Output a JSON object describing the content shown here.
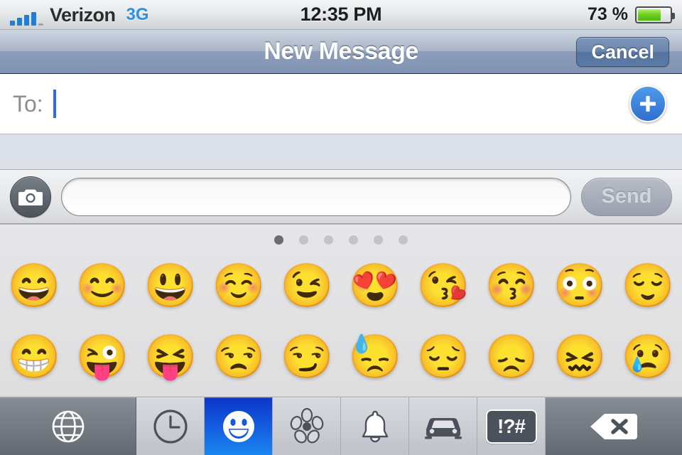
{
  "status_bar": {
    "carrier": "Verizon",
    "network": "3G",
    "time": "12:35 PM",
    "battery_percent": "73 %",
    "battery_level": 73,
    "signal_bars": 4,
    "signal_total": 5
  },
  "nav_bar": {
    "title": "New Message",
    "cancel_label": "Cancel"
  },
  "recipient": {
    "label": "To:",
    "value": "",
    "add_contact_icon": "plus-circle-icon"
  },
  "compose": {
    "camera_icon": "camera-icon",
    "message_value": "",
    "message_placeholder": "",
    "send_label": "Send",
    "send_enabled": false
  },
  "keyboard": {
    "page_count": 6,
    "active_page": 1,
    "rows": [
      [
        {
          "char": "😄",
          "name": "grinning-face-smiling-eyes"
        },
        {
          "char": "😊",
          "name": "smiling-face-smiling-eyes"
        },
        {
          "char": "😃",
          "name": "grinning-face-big-eyes"
        },
        {
          "char": "☺️",
          "name": "smiling-face-blush"
        },
        {
          "char": "😉",
          "name": "winking-face"
        },
        {
          "char": "😍",
          "name": "smiling-face-heart-eyes"
        },
        {
          "char": "😘",
          "name": "face-blowing-a-kiss"
        },
        {
          "char": "😚",
          "name": "kissing-face-closed-eyes"
        },
        {
          "char": "😳",
          "name": "flushed-face"
        },
        {
          "char": "😌",
          "name": "relieved-face"
        }
      ],
      [
        {
          "char": "😁",
          "name": "beaming-face-smiling-eyes"
        },
        {
          "char": "😜",
          "name": "winking-face-tongue"
        },
        {
          "char": "😝",
          "name": "squinting-face-tongue"
        },
        {
          "char": "😒",
          "name": "unamused-face"
        },
        {
          "char": "😏",
          "name": "smirking-face"
        },
        {
          "char": "😓",
          "name": "downcast-face-with-sweat"
        },
        {
          "char": "😔",
          "name": "pensive-face"
        },
        {
          "char": "😞",
          "name": "disappointed-face"
        },
        {
          "char": "😖",
          "name": "confounded-face"
        },
        {
          "char": "😢",
          "name": "crying-face"
        }
      ]
    ]
  },
  "kb_toolbar": {
    "keys": [
      {
        "name": "globe-key",
        "icon": "globe-icon",
        "type": "globe",
        "active": false
      },
      {
        "name": "category-recent",
        "icon": "clock-icon",
        "type": "cat",
        "active": false
      },
      {
        "name": "category-smileys",
        "icon": "smiley-icon",
        "type": "cat",
        "active": true
      },
      {
        "name": "category-nature",
        "icon": "flower-icon",
        "type": "cat",
        "active": false
      },
      {
        "name": "category-objects",
        "icon": "bell-icon",
        "type": "cat",
        "active": false
      },
      {
        "name": "category-vehicles",
        "icon": "car-icon",
        "type": "cat",
        "active": false
      },
      {
        "name": "category-symbols",
        "icon": "symbols-icon",
        "type": "cat",
        "active": false,
        "label": "!?#"
      },
      {
        "name": "delete-key",
        "icon": "backspace-icon",
        "type": "delete",
        "active": false
      }
    ]
  },
  "colors": {
    "accent_blue": "#2f6fd0",
    "active_key_blue": "#1358dd",
    "network_blue": "#2e90e0",
    "battery_green": "#6fd021",
    "nav_bar_blue_gray": "#8d9dba"
  }
}
